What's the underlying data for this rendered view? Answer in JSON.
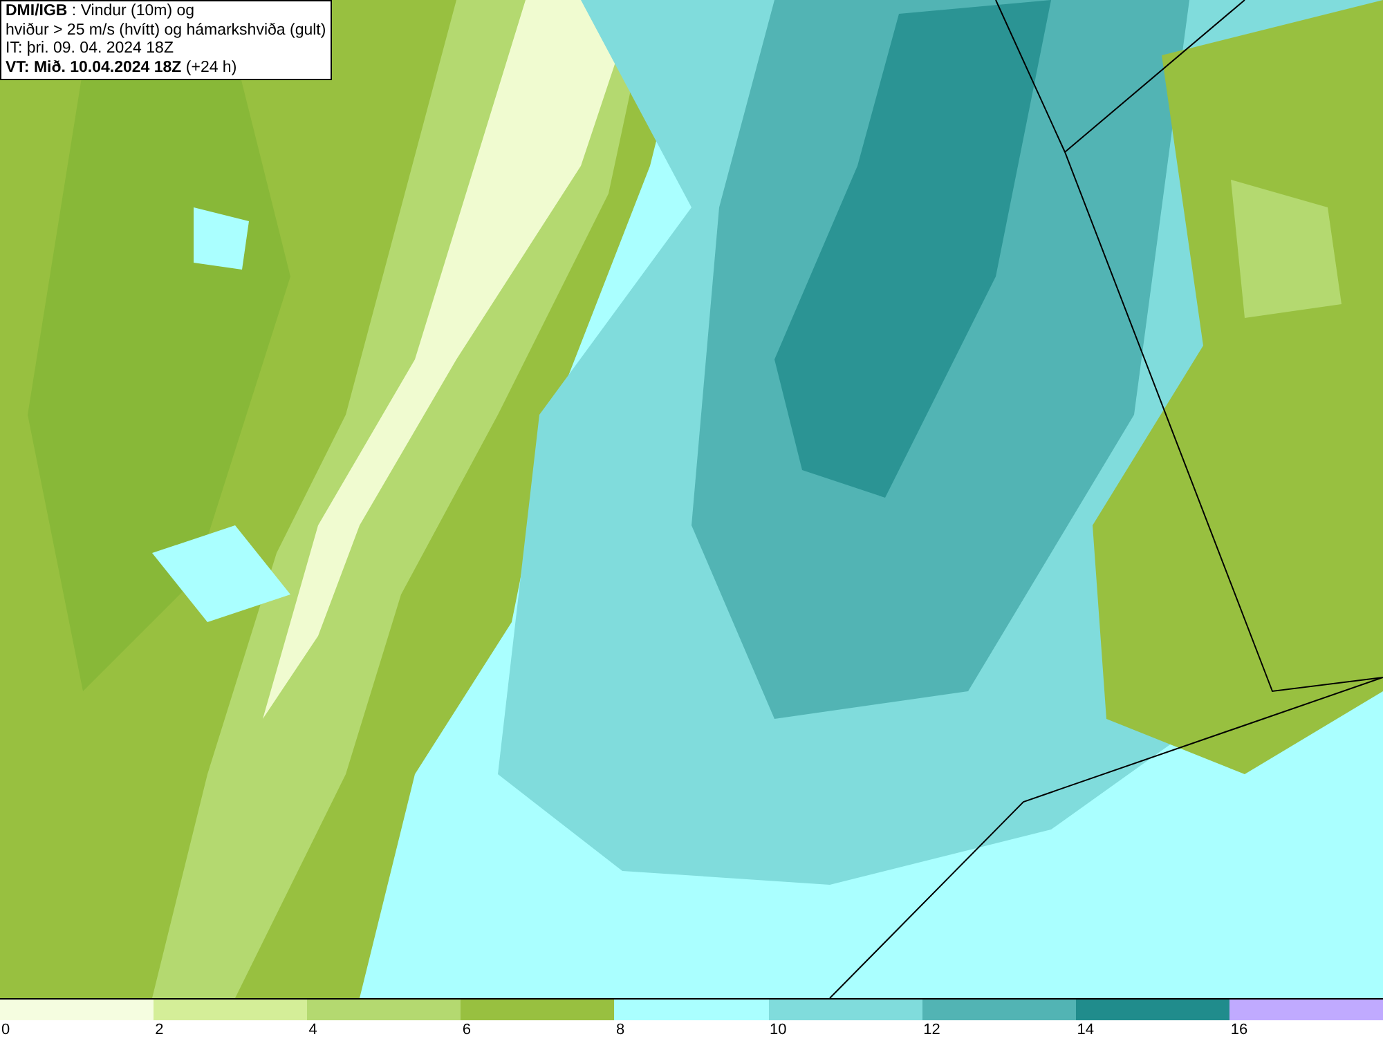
{
  "info_box": {
    "lines": [
      "**DMI/IGB** : Vindur (10m) og",
      "hviður > 25 m/s (hvítt) og hámarkshviða (gult)",
      "IT: þri. 09. 04. 2024 18Z",
      "**VT: Mið. 10.04.2024 18Z** (+24 h)"
    ]
  },
  "legend": [
    {
      "label": "0",
      "color": "#f5fde0"
    },
    {
      "label": "2",
      "color": "#d4ee98"
    },
    {
      "label": "4",
      "color": "#b4d970"
    },
    {
      "label": "6",
      "color": "#98c040"
    },
    {
      "label": "8",
      "color": "#aaffff"
    },
    {
      "label": "10",
      "color": "#80dcdc"
    },
    {
      "label": "12",
      "color": "#52b4b4"
    },
    {
      "label": "14",
      "color": "#208c8c"
    },
    {
      "label": "16",
      "color": "#c0aaff"
    }
  ]
}
